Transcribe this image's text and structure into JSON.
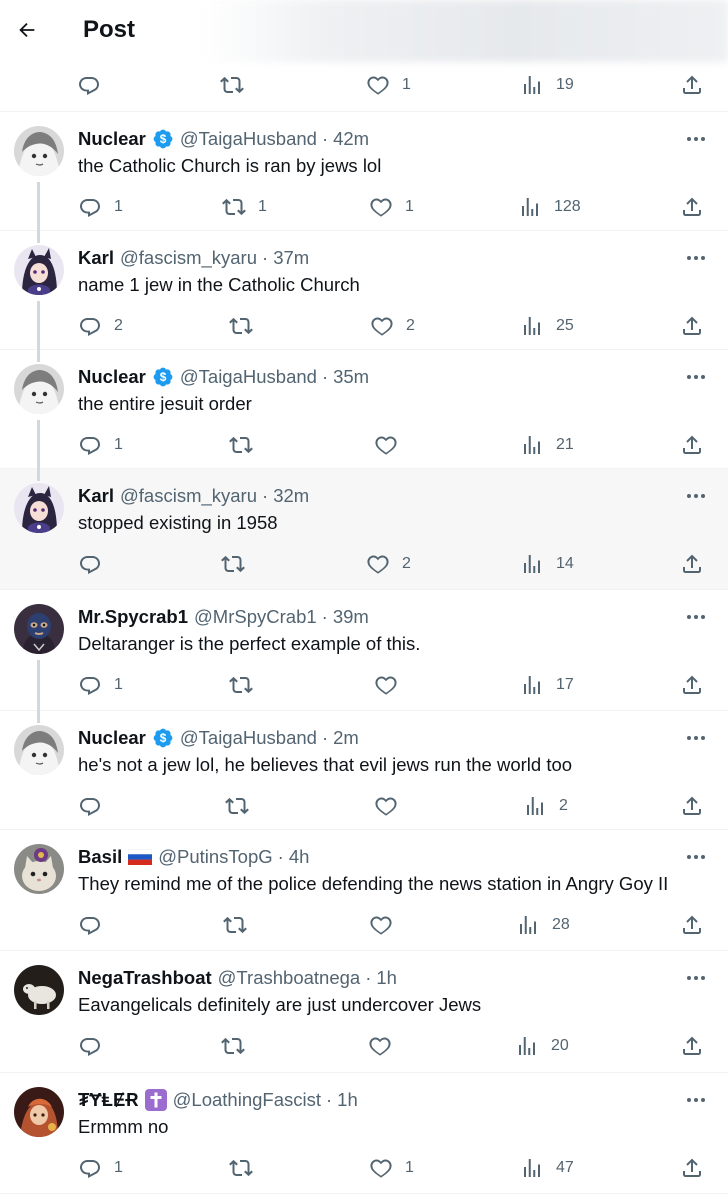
{
  "header": {
    "title": "Post",
    "back_icon": "arrow-left-icon"
  },
  "top_actions": {
    "replies": "",
    "reposts": "",
    "likes": "1",
    "views": "19"
  },
  "tweets": [
    {
      "name": "Nuclear",
      "verified": true,
      "handle": "@TaigaHusband",
      "time": "42m",
      "text": "the Catholic Church is ran by jews lol",
      "replies": "1",
      "reposts": "1",
      "likes": "1",
      "views": "128"
    },
    {
      "name": "Karl",
      "verified": false,
      "handle": "@fascism_kyaru",
      "time": "37m",
      "text": "name 1 jew in the Catholic Church",
      "replies": "2",
      "reposts": "",
      "likes": "2",
      "views": "25"
    },
    {
      "name": "Nuclear",
      "verified": true,
      "handle": "@TaigaHusband",
      "time": "35m",
      "text": "the entire jesuit order",
      "replies": "1",
      "reposts": "",
      "likes": "",
      "views": "21"
    },
    {
      "name": "Karl",
      "verified": false,
      "handle": "@fascism_kyaru",
      "time": "32m",
      "text": "stopped existing in 1958",
      "replies": "",
      "reposts": "",
      "likes": "2",
      "views": "14"
    },
    {
      "name": "Mr.Spycrab1",
      "verified": false,
      "handle": "@MrSpyCrab1",
      "time": "39m",
      "text": "Deltaranger is the perfect example of this.",
      "replies": "1",
      "reposts": "",
      "likes": "",
      "views": "17"
    },
    {
      "name": "Nuclear",
      "verified": true,
      "handle": "@TaigaHusband",
      "time": "2m",
      "text": "he's not a jew lol, he believes that evil jews run the world too",
      "replies": "",
      "reposts": "",
      "likes": "",
      "views": "2"
    },
    {
      "name": "Basil",
      "flag": "russia-flag-icon",
      "handle": "@PutinsTopG",
      "time": "4h",
      "text": "They remind me of the police defending the news station in Angry Goy II",
      "replies": "",
      "reposts": "",
      "likes": "",
      "views": "28"
    },
    {
      "name": "NegaTrashboat",
      "verified": false,
      "handle": "@Trashboatnega",
      "time": "1h",
      "text": "Eavangelicals definitely are just undercover Jews",
      "replies": "",
      "reposts": "",
      "likes": "",
      "views": "20"
    },
    {
      "name": "₮ɎⱠɆɌ",
      "badge_icon": "cross-emoji-icon",
      "handle": "@LoathingFascist",
      "time": "1h",
      "text": "Ermmm no",
      "replies": "1",
      "reposts": "",
      "likes": "1",
      "views": "47"
    }
  ],
  "colors": {
    "text": "#0f1419",
    "secondary": "#536471",
    "verified": "#1d9bf0",
    "thread_line": "#cfd9de",
    "divider": "#eff3f4",
    "highlight": "#f7f7f7"
  }
}
